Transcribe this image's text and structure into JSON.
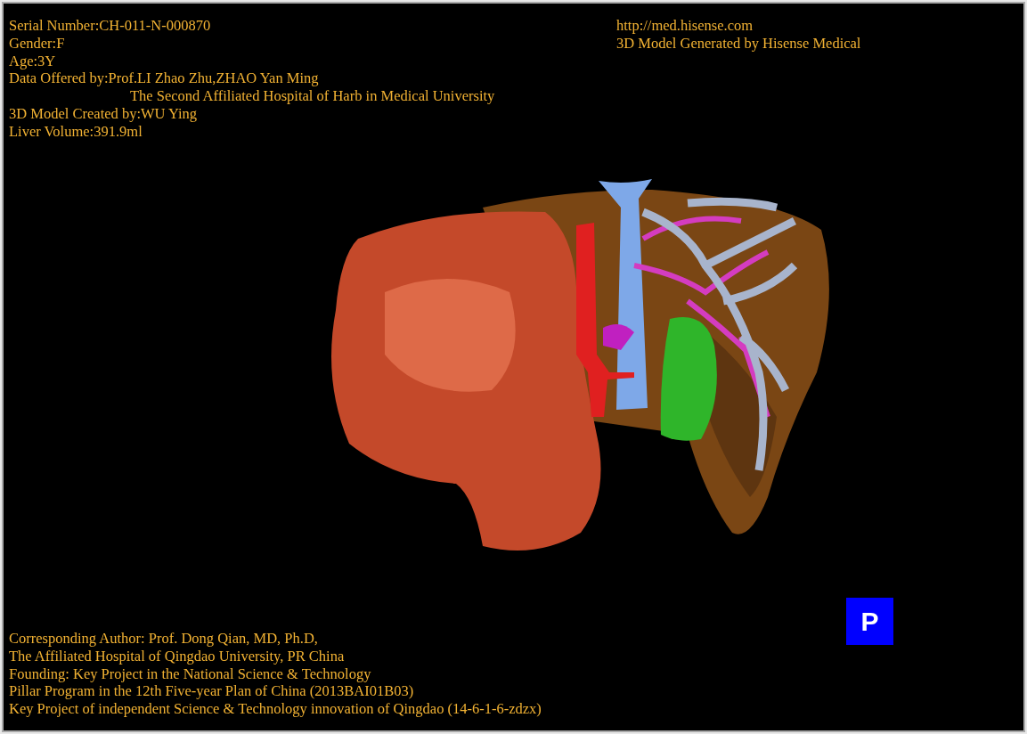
{
  "patient_info": [
    "Serial Number:CH-011-N-000870",
    "Gender:F",
    "Age:3Y",
    "Data Offered by:Prof.LI Zhao Zhu,ZHAO Yan Ming",
    "The Second Affiliated Hospital of Harb in Medical University",
    "3D Model Created by:WU Ying",
    "Liver Volume:391.9ml"
  ],
  "vendor_info": [
    "http://med.hisense.com",
    "3D Model Generated by Hisense Medical"
  ],
  "credits": [
    "Corresponding Author: Prof. Dong Qian, MD, Ph.D,",
    "The Affiliated Hospital of Qingdao University, PR China",
    "Founding: Key Project in the National Science & Technology",
    "Pillar Program in the 12th Five-year Plan of China (2013BAI01B03)",
    "Key Project of independent Science & Technology innovation of Qingdao (14-6-1-6-zdzx)"
  ],
  "view_button": {
    "label": "P"
  }
}
